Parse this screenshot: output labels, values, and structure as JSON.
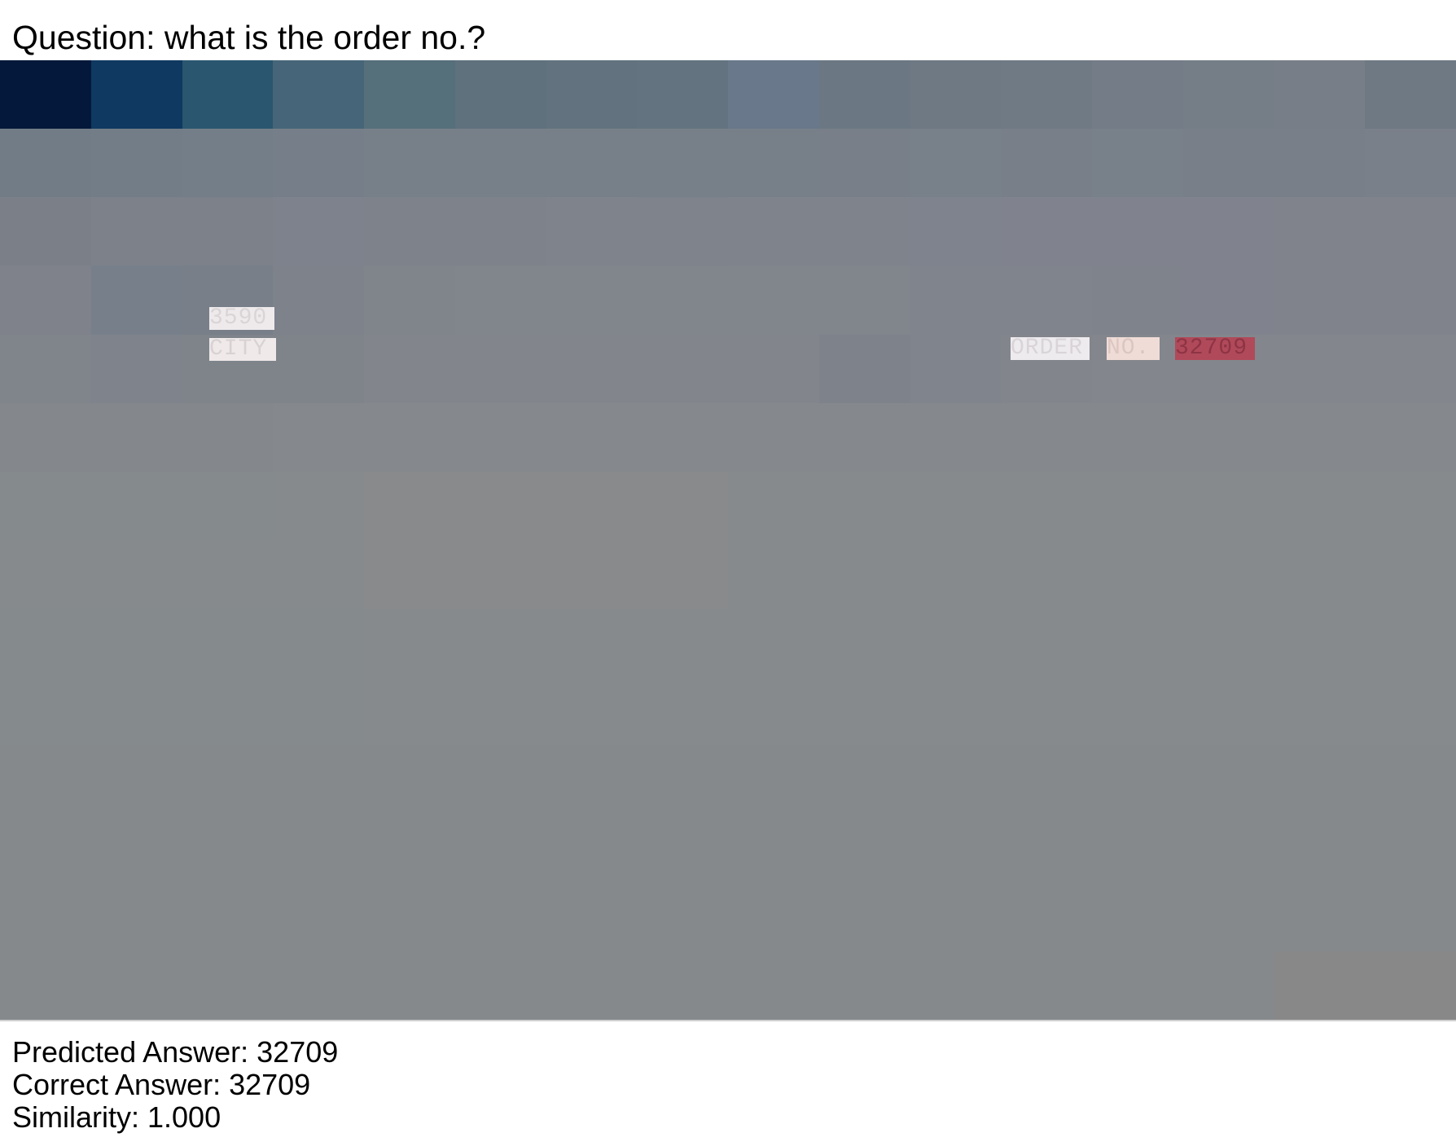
{
  "question": "Question: what is the order no.?",
  "heatmap": {
    "cols": 16,
    "rows": 14,
    "row_colors": [
      [
        "#03183a",
        "#0f3961",
        "#2a566f",
        "#466578",
        "#556f7b",
        "#5f717d",
        "#62737f",
        "#637480",
        "#69788a",
        "#6b7883",
        "#6e7984",
        "#707a85",
        "#737c87",
        "#757e87",
        "#787e88",
        "#6e7984"
      ],
      [
        "#717c86",
        "#737d87",
        "#747e88",
        "#767f89",
        "#778088",
        "#778089",
        "#778088",
        "#777f88",
        "#778089",
        "#787f89",
        "#788089",
        "#787f88",
        "#788089",
        "#787f88",
        "#787f88",
        "#7a808a"
      ],
      [
        "#7b8088",
        "#7c818a",
        "#7c818a",
        "#7e828c",
        "#7e838b",
        "#7e838b",
        "#7f838c",
        "#7e838c",
        "#7f838c",
        "#7f838c",
        "#7f838d",
        "#80838d",
        "#80838d",
        "#80838d",
        "#80838c",
        "#80838c"
      ],
      [
        "#7f828b",
        "#77808a",
        "#787f89",
        "#7d828b",
        "#80848b",
        "#81858c",
        "#81858c",
        "#81858c",
        "#81858c",
        "#81858c",
        "#80848d",
        "#80848d",
        "#7f838c",
        "#80838d",
        "#80838c",
        "#80838c"
      ],
      [
        "#80848b",
        "#7f838b",
        "#7f848b",
        "#7f848b",
        "#82868c",
        "#82868c",
        "#82868c",
        "#82868c",
        "#82868c",
        "#7e828b",
        "#80848c",
        "#82858c",
        "#83868d",
        "#83868d",
        "#83868d",
        "#83868d"
      ],
      [
        "#84878c",
        "#84878c",
        "#84878c",
        "#85888c",
        "#85888c",
        "#85888c",
        "#85888c",
        "#85888c",
        "#85888c",
        "#85888c",
        "#85888c",
        "#85888c",
        "#85888c",
        "#85888c",
        "#85888c",
        "#85888c"
      ],
      [
        "#858a8d",
        "#858a8d",
        "#858a8d",
        "#868a8d",
        "#888a8c",
        "#888a8c",
        "#888a8c",
        "#888a8c",
        "#878a8c",
        "#868a8c",
        "#868a8c",
        "#868a8c",
        "#868a8c",
        "#868a8c",
        "#868a8c",
        "#868a8c"
      ],
      [
        "#868a8d",
        "#868a8d",
        "#868a8d",
        "#868a8d",
        "#898a8b",
        "#898a8b",
        "#898a8b",
        "#898a8b",
        "#878a8c",
        "#868a8c",
        "#868a8c",
        "#868a8c",
        "#868a8c",
        "#868a8c",
        "#868a8c",
        "#868a8c"
      ],
      [
        "#858a8d",
        "#858a8d",
        "#858a8d",
        "#858a8d",
        "#878a8c",
        "#878a8c",
        "#878a8c",
        "#878a8c",
        "#868a8c",
        "#868a8c",
        "#868a8c",
        "#868a8c",
        "#868a8c",
        "#868a8c",
        "#868a8c",
        "#868a8c"
      ],
      [
        "#858a8d",
        "#858a8d",
        "#858a8d",
        "#858a8d",
        "#868a8c",
        "#868a8c",
        "#868a8c",
        "#868a8c",
        "#868a8c",
        "#868a8c",
        "#868a8c",
        "#868a8c",
        "#868a8c",
        "#868a8c",
        "#868a8c",
        "#868a8c"
      ],
      [
        "#85898c",
        "#85898c",
        "#85898c",
        "#85898c",
        "#85898c",
        "#85898c",
        "#85898c",
        "#85898c",
        "#85898c",
        "#85898c",
        "#85898c",
        "#85898c",
        "#85898c",
        "#85898c",
        "#85898c",
        "#85898c"
      ],
      [
        "#85898c",
        "#85898c",
        "#85898c",
        "#85898c",
        "#85898c",
        "#85898c",
        "#85898c",
        "#85898c",
        "#85898c",
        "#85898c",
        "#85898c",
        "#85898c",
        "#85898c",
        "#85898c",
        "#85898c",
        "#85898c"
      ],
      [
        "#85898c",
        "#85898c",
        "#85898c",
        "#85898c",
        "#85898c",
        "#85898c",
        "#85898c",
        "#85898c",
        "#85898c",
        "#85898c",
        "#85898c",
        "#85898c",
        "#85898c",
        "#85898c",
        "#85898c",
        "#85898c"
      ],
      [
        "#85898c",
        "#85898c",
        "#85898c",
        "#85898c",
        "#85898c",
        "#85898c",
        "#85898c",
        "#85898c",
        "#85898c",
        "#85898c",
        "#85898c",
        "#85898c",
        "#85898c",
        "#85898c",
        "#888889",
        "#888889"
      ]
    ]
  },
  "tokens": [
    {
      "id": "3590",
      "text": "3590",
      "bg": "#eeeaec",
      "color": "#d9d4d6"
    },
    {
      "id": "city",
      "text": "CITY",
      "bg": "#efe9ea",
      "color": "#d8d2d3"
    },
    {
      "id": "order",
      "text": "ORDER",
      "bg": "#eeebee",
      "color": "#d8d4d8"
    },
    {
      "id": "no",
      "text": "NO.",
      "bg": "#f0dcd7",
      "color": "#dcc6c2"
    },
    {
      "id": "number",
      "text": "32709",
      "bg": "#b04a5a",
      "color": "#8e3444"
    }
  ],
  "footer": {
    "predicted": "Predicted Answer: 32709",
    "correct": "Correct Answer: 32709",
    "similarity": "Similarity: 1.000"
  }
}
